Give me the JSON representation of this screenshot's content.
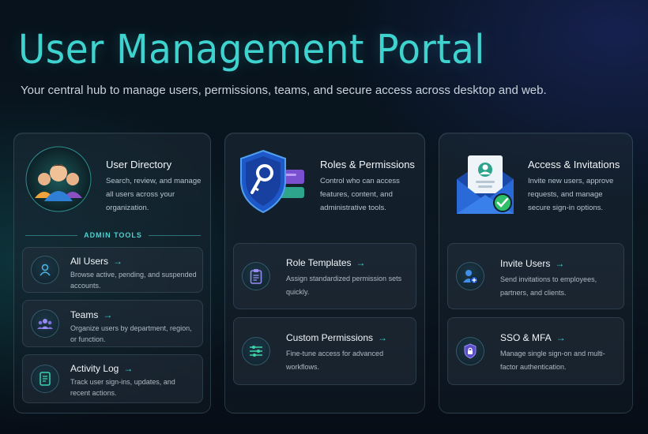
{
  "header": {
    "title": "User Management Portal",
    "subtitle": "Your central hub to manage users, permissions, teams, and secure access across desktop and web."
  },
  "cards": [
    {
      "title": "User Directory",
      "desc": "Search, review, and manage all users across your organization.",
      "section_label": "ADMIN TOOLS",
      "items": [
        {
          "title": "All Users",
          "desc": "Browse active, pending, and suspended accounts."
        },
        {
          "title": "Teams",
          "desc": "Organize users by department, region, or function."
        },
        {
          "title": "Activity Log",
          "desc": "Track user sign-ins, updates, and recent actions."
        }
      ]
    },
    {
      "title": "Roles & Permissions",
      "desc": "Control who can access features, content, and administrative tools.",
      "items": [
        {
          "title": "Role Templates",
          "desc": "Assign standardized permission sets quickly."
        },
        {
          "title": "Custom Permissions",
          "desc": "Fine-tune access for advanced workflows."
        }
      ]
    },
    {
      "title": "Access & Invitations",
      "desc": "Invite new users, approve requests, and manage secure sign-in options.",
      "items": [
        {
          "title": "Invite Users",
          "desc": "Send invitations to employees, partners, and clients."
        },
        {
          "title": "SSO & MFA",
          "desc": "Manage single sign-on and multi-factor authentication."
        }
      ]
    }
  ],
  "arrow_glyph": "→",
  "icons": {
    "user_directory": "users-group-icon",
    "roles": "shield-key-icon",
    "access": "envelope-invite-icon",
    "all_users": "user-icon",
    "teams": "team-icon",
    "activity_log": "document-icon",
    "role_templates": "clipboard-icon",
    "custom_permissions": "sliders-icon",
    "invite_users": "user-add-icon",
    "sso_mfa": "lock-shield-icon"
  },
  "colors": {
    "accent": "#3fd3d0",
    "background": "#0a1620",
    "card": "#1e2c38",
    "purple": "#8a7cf0"
  }
}
